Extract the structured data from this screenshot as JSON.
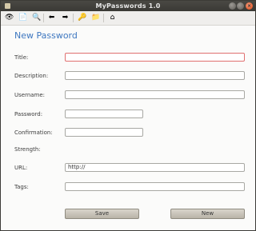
{
  "window": {
    "title": "MyPasswords 1.0",
    "close_glyph": "×"
  },
  "toolbar": {
    "icons": [
      {
        "name": "view-icon",
        "glyph": "👁"
      },
      {
        "name": "copy-icon",
        "glyph": "📄"
      },
      {
        "name": "search-icon",
        "glyph": "🔍"
      },
      {
        "name": "import-icon",
        "glyph": "⬅"
      },
      {
        "name": "export-icon",
        "glyph": "➡"
      },
      {
        "name": "key-icon",
        "glyph": "🔑"
      },
      {
        "name": "folder-key-icon",
        "glyph": "📁"
      },
      {
        "name": "home-icon",
        "glyph": "⌂"
      }
    ]
  },
  "form": {
    "heading": "New Password",
    "title_label": "Title:",
    "description_label": "Description:",
    "username_label": "Username:",
    "password_label": "Password:",
    "confirmation_label": "Confirmation:",
    "strength_label": "Strength:",
    "url_label": "URL:",
    "url_value": "http://",
    "tags_label": "Tags:"
  },
  "buttons": {
    "save": "Save",
    "new": "New"
  },
  "colors": {
    "heading": "#3f78c0",
    "focus_border": "#e07070"
  }
}
